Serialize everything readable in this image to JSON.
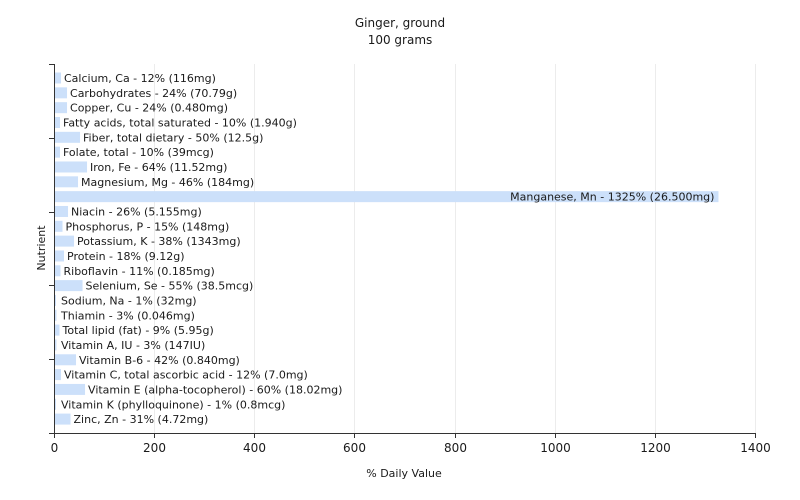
{
  "chart_data": {
    "type": "bar",
    "orientation": "horizontal",
    "title": "Ginger, ground",
    "subtitle": "100 grams",
    "xlabel": "% Daily Value",
    "ylabel": "Nutrient",
    "xlim": [
      0,
      1400
    ],
    "xticks": [
      0,
      200,
      400,
      600,
      800,
      1000,
      1200,
      1400
    ],
    "grid": true,
    "bar_color": "#cce0fa",
    "categories": [
      "Calcium, Ca - 12% (116mg)",
      "Carbohydrates - 24% (70.79g)",
      "Copper, Cu - 24% (0.480mg)",
      "Fatty acids, total saturated - 10% (1.940g)",
      "Fiber, total dietary - 50% (12.5g)",
      "Folate, total - 10% (39mcg)",
      "Iron, Fe - 64% (11.52mg)",
      "Magnesium, Mg - 46% (184mg)",
      "Manganese, Mn - 1325% (26.500mg)",
      "Niacin - 26% (5.155mg)",
      "Phosphorus, P - 15% (148mg)",
      "Potassium, K - 38% (1343mg)",
      "Protein - 18% (9.12g)",
      "Riboflavin - 11% (0.185mg)",
      "Selenium, Se - 55% (38.5mcg)",
      "Sodium, Na - 1% (32mg)",
      "Thiamin - 3% (0.046mg)",
      "Total lipid (fat) - 9% (5.95g)",
      "Vitamin A, IU - 3% (147IU)",
      "Vitamin B-6 - 42% (0.840mg)",
      "Vitamin C, total ascorbic acid - 12% (7.0mg)",
      "Vitamin E (alpha-tocopherol) - 60% (18.02mg)",
      "Vitamin K (phylloquinone) - 1% (0.8mcg)",
      "Zinc, Zn - 31% (4.72mg)"
    ],
    "values": [
      12,
      24,
      24,
      10,
      50,
      10,
      64,
      46,
      1325,
      26,
      15,
      38,
      18,
      11,
      55,
      1,
      3,
      9,
      3,
      42,
      12,
      60,
      1,
      31
    ]
  }
}
